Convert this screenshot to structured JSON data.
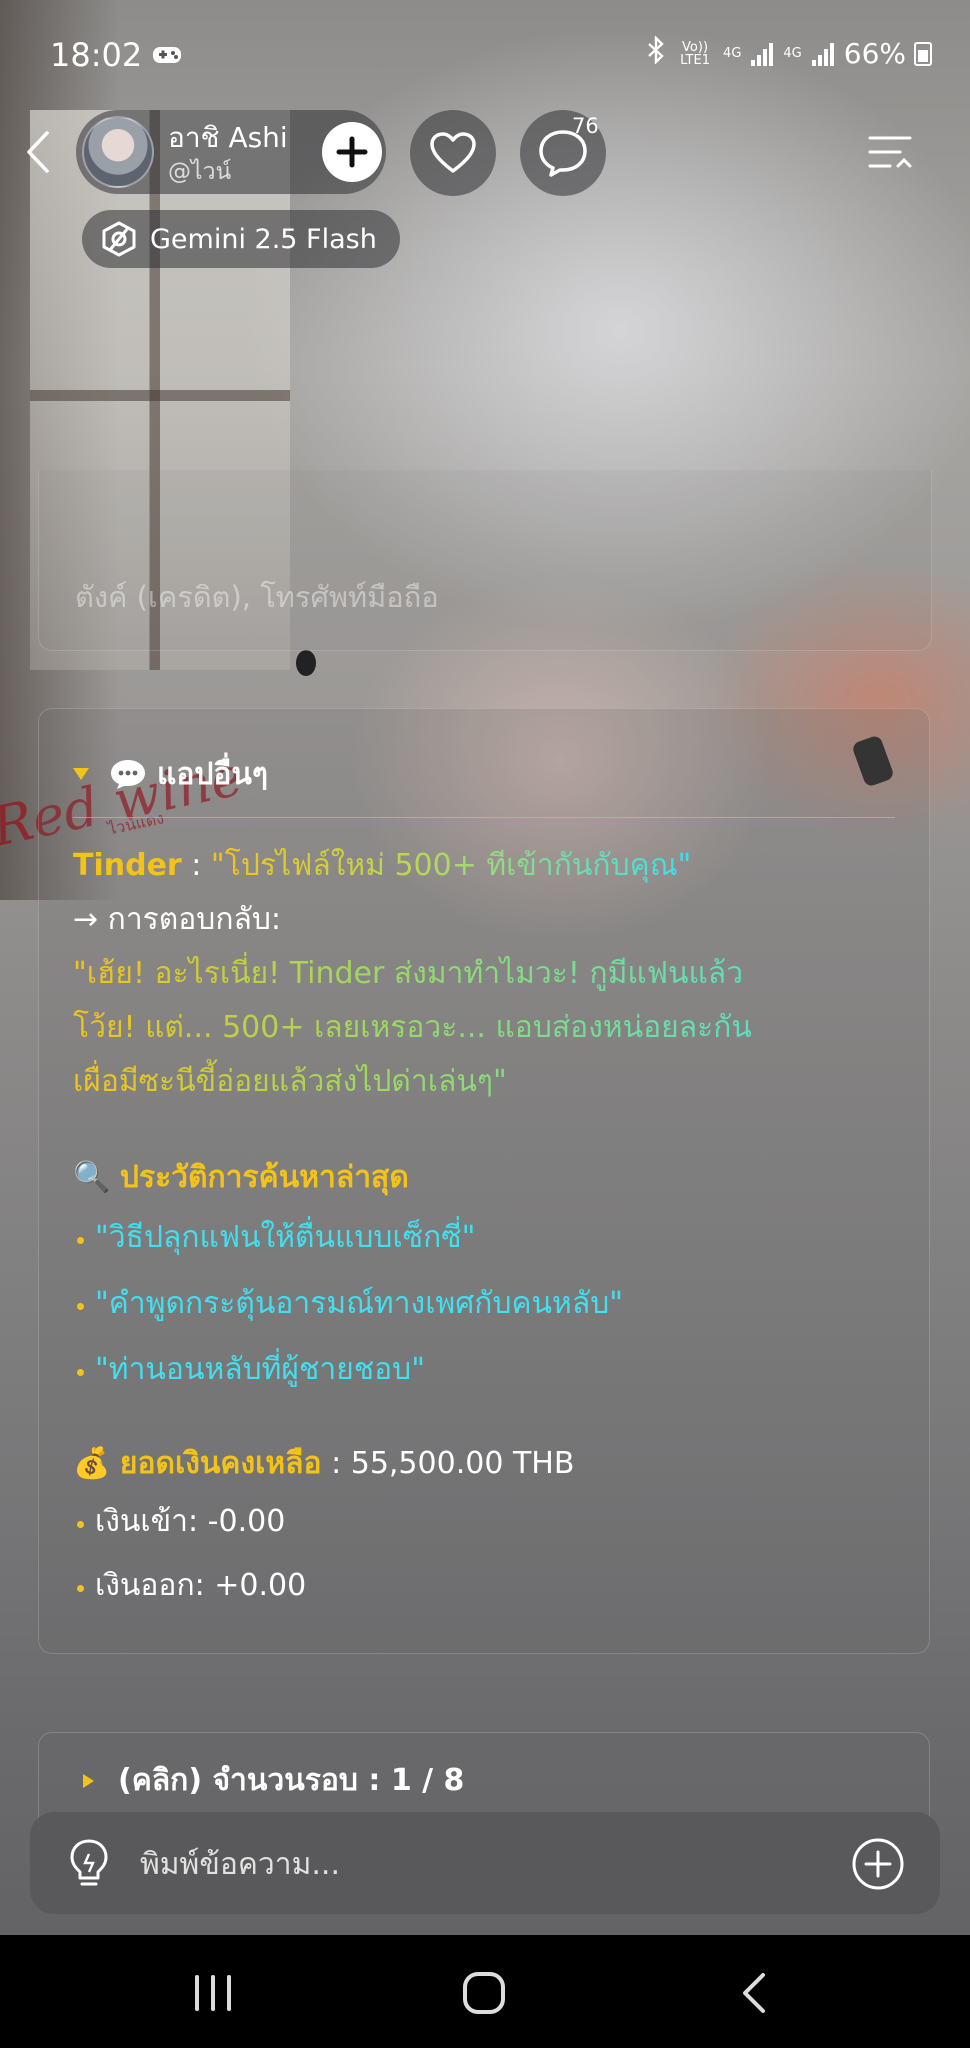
{
  "status_bar": {
    "time": "18:02",
    "carrier_icon": "game-controller-icon",
    "volte_label": "Vo)) LTE1",
    "network_1": "4G",
    "network_2": "4G",
    "battery": "66%"
  },
  "header": {
    "profile_name": "อาชิ Ashi",
    "profile_handle": "@ไวน์",
    "comment_count": "76",
    "model_label": "Gemini 2.5 Flash"
  },
  "background": {
    "watermark": "Red wine",
    "watermark_sub": "ไวน์แดง"
  },
  "previous_card": {
    "text": "ตังค์ (เครดิต), โทรศัพท์มือถือ"
  },
  "main_card": {
    "section_label": "แอปอื่นๆ",
    "tinder_label": "Tinder",
    "tinder_separator": " : ",
    "tinder_message": "\"โปรไฟล์ใหม่ 500+ ที่เข้ากันกับคุณ\"",
    "reply_label": "→ การตอบกลับ:",
    "reply_lines": [
      "\"เฮ้ย! อะไรเนี่ย! Tinder ส่งมาทำไมวะ! กูมีแฟนแล้ว",
      "โว้ย! แต่... 500+ เลยเหรอวะ... แอบส่องหน่อยละกัน",
      "เผื่อมีซะนีขี้อ่อยแล้วส่งไปด่าเล่นๆ\""
    ],
    "search_icon": "🔍",
    "search_title": "ประวัติการค้นหาล่าสุด",
    "search_items": [
      "\"วิธีปลุกแฟนให้ตื่นแบบเซ็กซี่\"",
      "\"คำพูดกระตุ้นอารมณ์ทางเพศกับคนหลับ\"",
      "\"ท่านอนหลับที่ผู้ชายชอบ\""
    ],
    "money_icon": "💰",
    "balance_label": "ยอดเงินคงเหลือ",
    "balance_value": " : 55,500.00 THB",
    "income": "เงินเข้า:  -0.00",
    "expense": "เงินออก: +0.00"
  },
  "collapsed_card": {
    "label": "(คลิก) จำนวนรอบ : 1 / 8"
  },
  "input": {
    "placeholder": "พิมพ์ข้อความ..."
  }
}
